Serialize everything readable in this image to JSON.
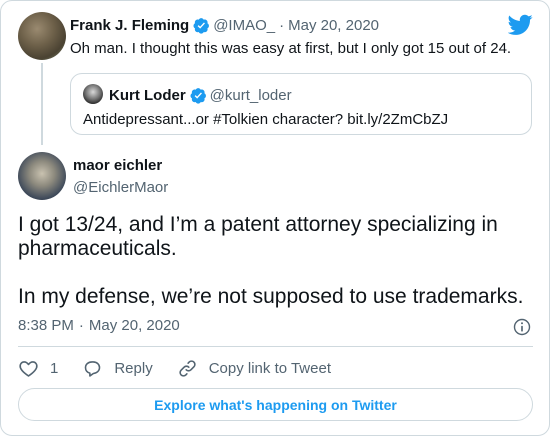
{
  "original_tweet": {
    "author_name": "Frank J. Fleming",
    "handle": "@IMAO_",
    "separator": "·",
    "date": "May 20, 2020",
    "text": "Oh man. I thought this was easy at first, but I only got 15 out of 24."
  },
  "quoted_tweet": {
    "author_name": "Kurt Loder",
    "handle": "@kurt_loder",
    "text": "Antidepressant...or #Tolkien character? bit.ly/2ZmCbZJ"
  },
  "reply": {
    "author_name": "maor eichler",
    "handle": "@EichlerMaor",
    "body_line_1": "I got 13/24, and I’m a patent attorney specializing in",
    "body_line_2": "pharmaceuticals.",
    "body_line_3": "In my defense, we’re not supposed to use trademarks.",
    "time": "8:38 PM",
    "time_separator": "·",
    "date": "May 20, 2020"
  },
  "actions": {
    "like_count": "1",
    "reply_label": "Reply",
    "copy_link_label": "Copy link to Tweet"
  },
  "explore_label": "Explore what's happening on Twitter",
  "icons": [
    "twitter-bird-icon",
    "verified-badge-icon",
    "info-icon",
    "heart-icon",
    "reply-bubble-icon",
    "link-icon"
  ],
  "colors": {
    "brand": "#1d9bf0",
    "text": "#0f1419",
    "secondary": "#536471",
    "border": "#cfd9de"
  }
}
